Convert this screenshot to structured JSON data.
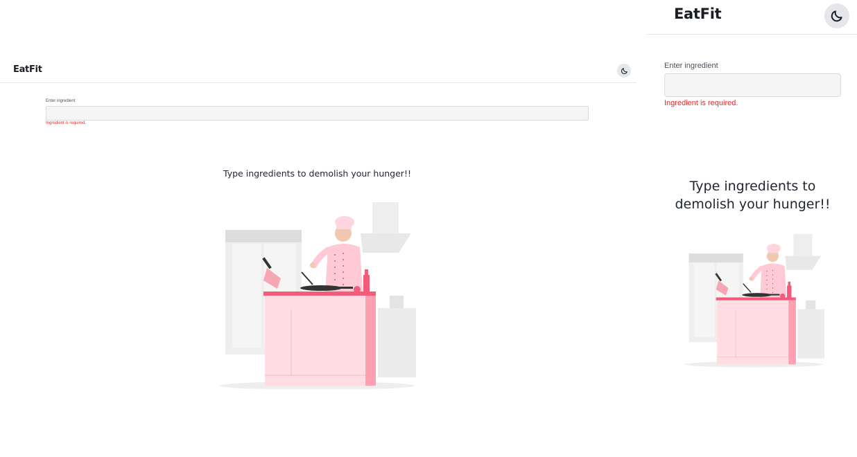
{
  "app": {
    "brand": "EatFit",
    "theme_toggle_icon": "moon-icon"
  },
  "search": {
    "label": "Enter ingredient",
    "value": "",
    "placeholder": "",
    "error": "Ingredient is required."
  },
  "hero": {
    "message": "Type ingredients to demolish your hunger!!",
    "illustration": "chef-cooking-illustration"
  },
  "colors": {
    "accent_pink": "#f25c7a",
    "counter_pink": "#ffdde3",
    "error_red": "#e02d2d"
  }
}
